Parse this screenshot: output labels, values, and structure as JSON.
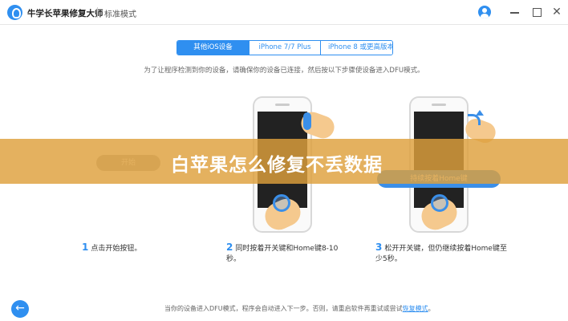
{
  "app": {
    "title": "牛学长苹果修复大师",
    "mode": "标准模式"
  },
  "window": {
    "close_glyph": "✕"
  },
  "tabs": [
    {
      "label": "其他iOS设备",
      "active": true
    },
    {
      "label": "iPhone 7/7 Plus",
      "active": false
    },
    {
      "label": "iPhone 8 或更高版本",
      "active": false
    }
  ],
  "instruction": "为了让程序检测到你的设备，请确保你的设备已连接，然后按以下步骤使设备进入DFU模式。",
  "start_button": "开始",
  "hold_button": "持续按着Home键",
  "banner": "白苹果怎么修复不丢数据",
  "steps": [
    {
      "num": "1",
      "text": "点击开始按钮。"
    },
    {
      "num": "2",
      "text": "同时按着开关键和Home键8-10秒。"
    },
    {
      "num": "3",
      "text": "松开开关键，但仍继续按着Home键至少5秒。"
    }
  ],
  "footer": {
    "back_glyph": "←",
    "text": "当你的设备进入DFU模式，程序会自动进入下一步。否则，请重启软件再重试或尝试",
    "link": "恢复模式",
    "end": "。"
  },
  "colors": {
    "accent": "#2f8ff0",
    "banner": "#dea03c",
    "disabled": "#b9b9b9"
  }
}
